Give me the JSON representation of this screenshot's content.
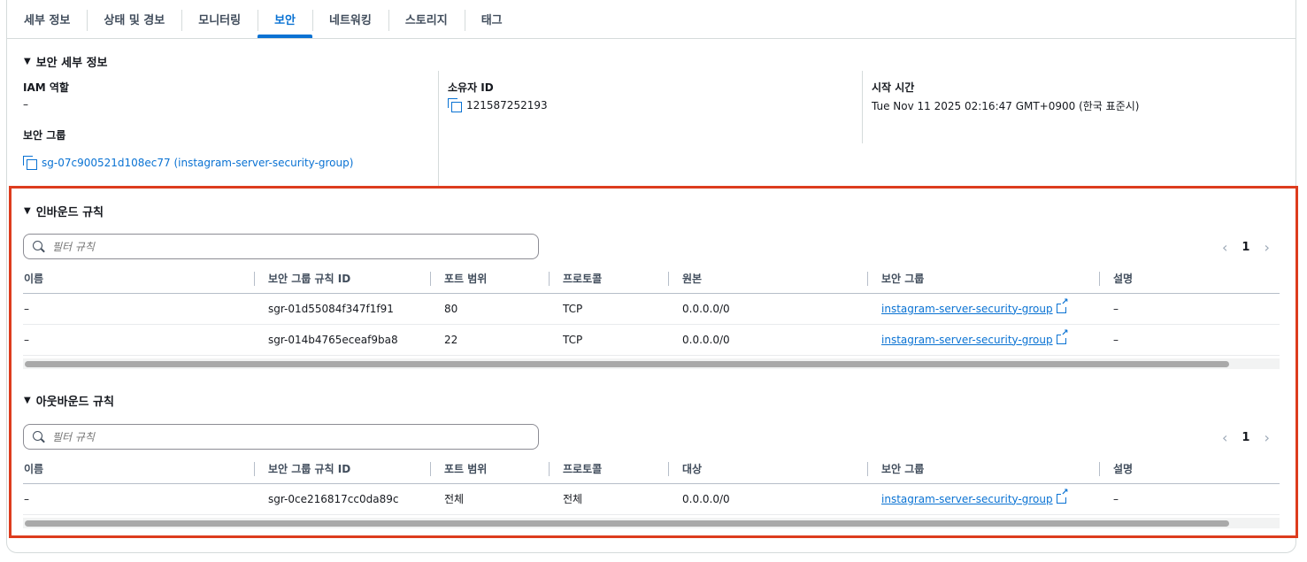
{
  "tabs": [
    "세부 정보",
    "상태 및 경보",
    "모니터링",
    "보안",
    "네트워킹",
    "스토리지",
    "태그"
  ],
  "active_tab_index": 3,
  "security_details": {
    "title": "보안 세부 정보",
    "iam_role_label": "IAM 역할",
    "iam_role_value": "–",
    "security_group_label": "보안 그룹",
    "security_group_value": "sg-07c900521d108ec77 (instagram-server-security-group)",
    "owner_id_label": "소유자 ID",
    "owner_id_value": "121587252193",
    "launch_time_label": "시작 시간",
    "launch_time_value": "Tue Nov 11 2025 02:16:47 GMT+0900 (한국 표준시)"
  },
  "inbound": {
    "title": "인바운드 규칙",
    "filter_placeholder": "필터 규칙",
    "page": "1",
    "columns": [
      "이름",
      "보안 그룹 규칙 ID",
      "포트 범위",
      "프로토콜",
      "원본",
      "보안 그룹",
      "설명"
    ],
    "rows": [
      [
        "–",
        "sgr-01d55084f347f1f91",
        "80",
        "TCP",
        "0.0.0.0/0",
        "instagram-server-security-group",
        "–"
      ],
      [
        "–",
        "sgr-014b4765eceaf9ba8",
        "22",
        "TCP",
        "0.0.0.0/0",
        "instagram-server-security-group",
        "–"
      ]
    ]
  },
  "outbound": {
    "title": "아웃바운드 규칙",
    "filter_placeholder": "필터 규칙",
    "page": "1",
    "columns": [
      "이름",
      "보안 그룹 규칙 ID",
      "포트 범위",
      "프로토콜",
      "대상",
      "보안 그룹",
      "설명"
    ],
    "rows": [
      [
        "–",
        "sgr-0ce216817cc0da89c",
        "전체",
        "전체",
        "0.0.0.0/0",
        "instagram-server-security-group",
        "–"
      ]
    ]
  },
  "colors": {
    "accent": "#0972d3",
    "highlight_box": "#dd3c1e"
  }
}
